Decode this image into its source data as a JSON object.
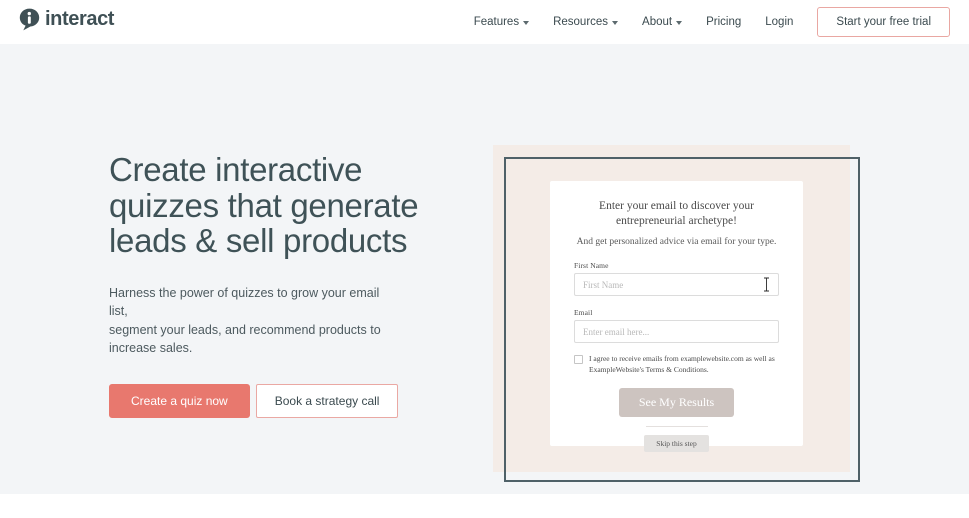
{
  "header": {
    "brand": {
      "name": "interact",
      "mark_icon": "interact-droplet-logo"
    },
    "nav": [
      {
        "label": "Features",
        "has_dropdown": true
      },
      {
        "label": "Resources",
        "has_dropdown": true
      },
      {
        "label": "About",
        "has_dropdown": true
      },
      {
        "label": "Pricing",
        "has_dropdown": false
      },
      {
        "label": "Login",
        "has_dropdown": false
      }
    ],
    "trial_button": "Start your free trial"
  },
  "hero": {
    "headline": "Create interactive\nquizzes that generate\nleads & sell products",
    "subheadline": "Harness the power of quizzes to grow your email list,\nsegment your leads, and recommend products to\nincrease sales.",
    "primary_cta": "Create a quiz now",
    "secondary_cta": "Book a strategy call"
  },
  "quiz_preview": {
    "title": "Enter your email to discover your\nentrepreneurial archetype!",
    "subtitle": "And get personalized advice via email for your type.",
    "fields": [
      {
        "label": "First Name",
        "placeholder": "First Name",
        "value": ""
      },
      {
        "label": "Email",
        "placeholder": "Enter email here...",
        "value": ""
      }
    ],
    "consent_text": "I agree to receive emails from examplewebsite.com as well as ExampleWebsite's Terms & Conditions.",
    "submit_button": "See My Results",
    "skip_button": "Skip this step",
    "cursor_icon": "text-ibeam-cursor"
  },
  "colors": {
    "brand_dark": "#3f5055",
    "coral": "#e8786e",
    "coral_border": "#e9a7a2",
    "hero_bg": "#f3f5f7",
    "beige_panel": "#f4ece7",
    "frame_border": "#4f6168",
    "submit_grey": "#cdc4c0"
  }
}
